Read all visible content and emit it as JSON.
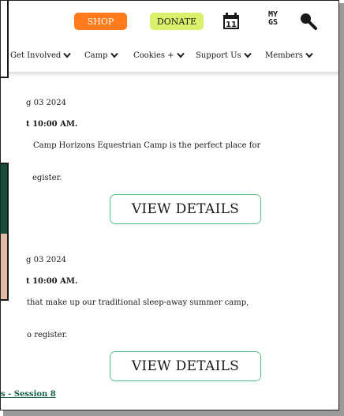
{
  "header": {
    "shop_label": "SHOP",
    "donate_label": "DONATE",
    "calendar_day": "11",
    "my_gs_line1": "MY",
    "my_gs_line2": "GS",
    "shop_color": "#ff7a1a",
    "donate_color": "#d8f06a"
  },
  "nav": {
    "items": [
      {
        "label": "Get Involved"
      },
      {
        "label": "Camp"
      },
      {
        "label": "Cookies +"
      },
      {
        "label": "Support Us"
      },
      {
        "label": "Members"
      }
    ]
  },
  "events": [
    {
      "date": "g 03 2024",
      "time": "t 10:00 AM.",
      "description": "Camp Horizons Equestrian Camp is the perfect place for",
      "register": "egister.",
      "button": "VIEW DETAILS"
    },
    {
      "date": "g 03 2024",
      "time": "t 10:00 AM.",
      "description": "that make up our traditional sleep-away summer camp,",
      "register": "o register.",
      "button": "VIEW DETAILS"
    }
  ],
  "next_event_link": "s - Session 8",
  "colors": {
    "accent_green": "#5bbf8a",
    "dark_green": "#174f3b",
    "link_green": "#17604a"
  }
}
